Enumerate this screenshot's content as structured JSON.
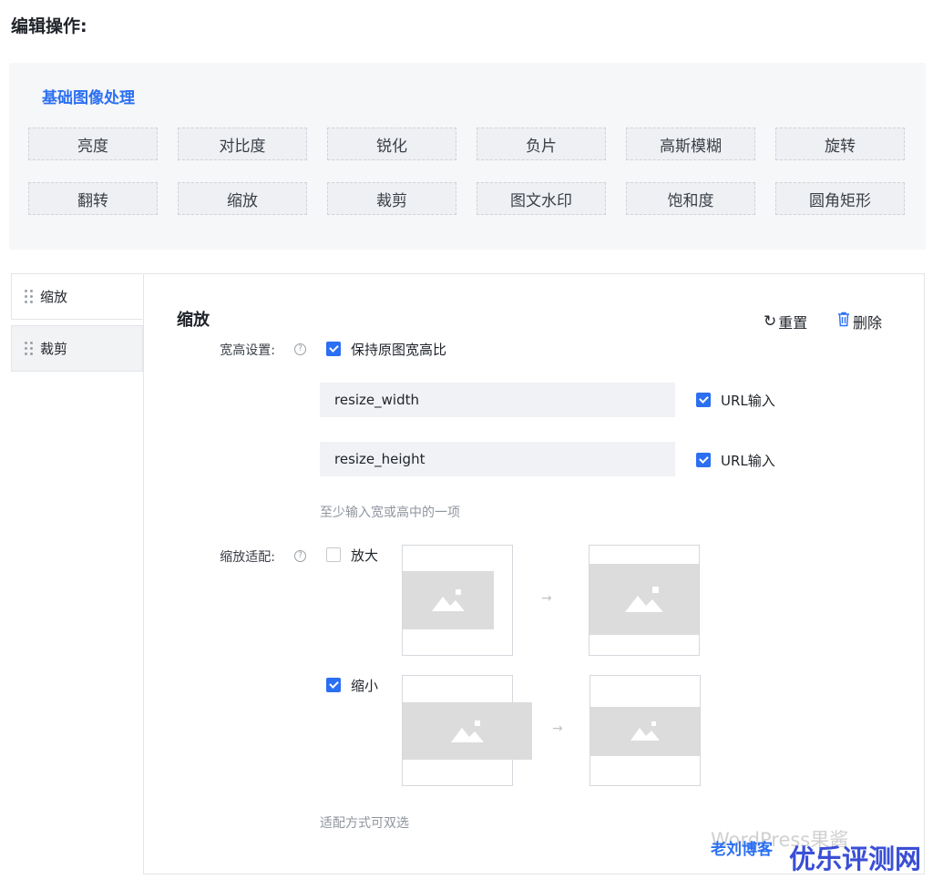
{
  "section_title": "编辑操作:",
  "ops_group": {
    "title": "基础图像处理",
    "row1": [
      "亮度",
      "对比度",
      "锐化",
      "负片",
      "高斯模糊",
      "旋转"
    ],
    "row2": [
      "翻转",
      "缩放",
      "裁剪",
      "图文水印",
      "饱和度",
      "圆角矩形"
    ]
  },
  "op_list": [
    {
      "label": "缩放",
      "active": true
    },
    {
      "label": "裁剪",
      "active": false
    }
  ],
  "editor": {
    "title": "缩放",
    "reset_label": "重置",
    "delete_label": "删除",
    "size_label": "宽高设置:",
    "keep_ratio_label": "保持原图宽高比",
    "keep_ratio_checked": true,
    "width_input_value": "resize_width",
    "height_input_value": "resize_height",
    "url_input_label": "URL输入",
    "width_url_checked": true,
    "height_url_checked": true,
    "size_hint": "至少输入宽或高中的一项",
    "fit_label": "缩放适配:",
    "enlarge_label": "放大",
    "enlarge_checked": false,
    "shrink_label": "缩小",
    "shrink_checked": true,
    "fit_hint": "适配方式可双选"
  },
  "icons": {
    "reset": "refresh-icon",
    "delete": "trash-icon",
    "help": "question-circle-icon",
    "drag": "drag-handle-icon",
    "image": "image-placeholder-icon",
    "arrow": "arrow-right-icon"
  },
  "watermark": {
    "text1": "WordPress果酱",
    "text2": "老刘博客",
    "text3": "优乐评测网"
  },
  "colors": {
    "accent": "#2b6ff2",
    "panel_bg": "#f6f7f9",
    "input_bg": "#f1f2f5",
    "placeholder_bg": "#dcdcdc"
  }
}
